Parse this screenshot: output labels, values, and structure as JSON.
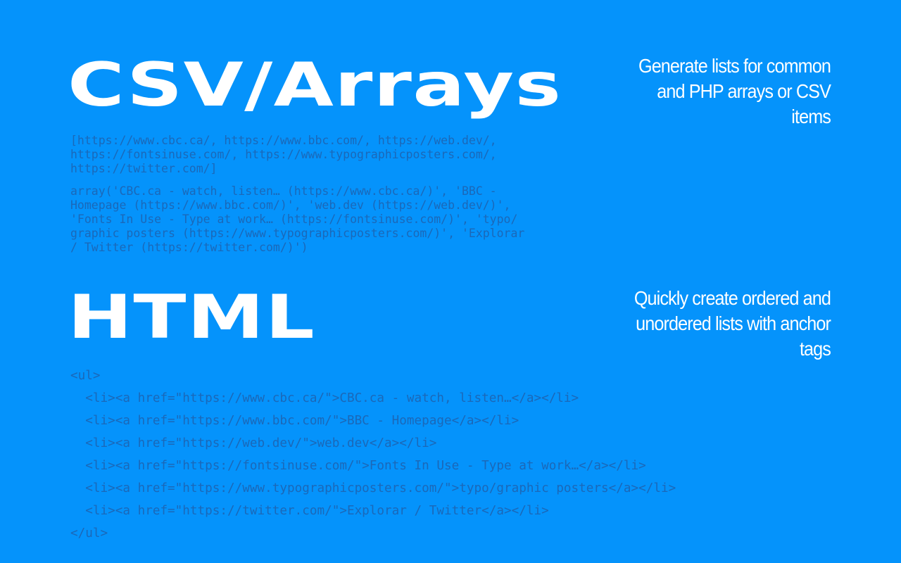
{
  "csv_section": {
    "title": "CSV/Arrays",
    "description": "Generate lists for common and PHP arrays or CSV items",
    "csv_lines": [
      "[https://www.cbc.ca/, https://www.bbc.com/, https://web.dev/,",
      "https://fontsinuse.com/, https://www.typographicposters.com/,",
      "https://twitter.com/]"
    ],
    "php_lines": [
      "array('CBC.ca - watch, listen… (https://www.cbc.ca/)', 'BBC -",
      "Homepage (https://www.bbc.com/)', 'web.dev (https://web.dev/)',",
      "'Fonts In Use - Type at work… (https://fontsinuse.com/)', 'typo/",
      "graphic posters (https://www.typographicposters.com/)', 'Explorar",
      "/ Twitter (https://twitter.com/)')"
    ]
  },
  "html_section": {
    "title": "HTML",
    "description": "Quickly create ordered and unordered lists with anchor tags",
    "code_lines": [
      "<ul>",
      "  <li><a href=\"https://www.cbc.ca/\">CBC.ca - watch, listen…</a></li>",
      "  <li><a href=\"https://www.bbc.com/\">BBC - Homepage</a></li>",
      "  <li><a href=\"https://web.dev/\">web.dev</a></li>",
      "  <li><a href=\"https://fontsinuse.com/\">Fonts In Use - Type at work…</a></li>",
      "  <li><a href=\"https://www.typographicposters.com/\">typo/graphic posters</a></li>",
      "  <li><a href=\"https://twitter.com/\">Explorar / Twitter</a></li>",
      "</ul>"
    ]
  },
  "colors": {
    "background": "#0593fb",
    "heading": "#ffffff",
    "code": "#1b68b8"
  }
}
